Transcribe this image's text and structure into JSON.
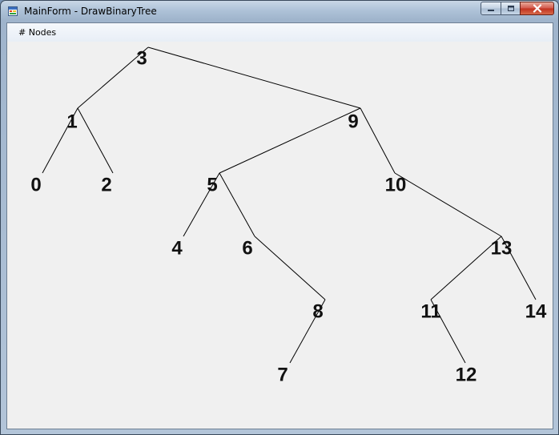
{
  "window": {
    "title": "MainForm - DrawBinaryTree",
    "icons": {
      "app": "app-form-icon",
      "minimize": "minimize-icon",
      "maximize": "maximize-icon",
      "close": "close-icon"
    }
  },
  "menu": {
    "items": [
      {
        "label": "# Nodes"
      }
    ]
  },
  "tree": {
    "nodes": [
      "0",
      "1",
      "2",
      "3",
      "4",
      "5",
      "6",
      "7",
      "8",
      "9",
      "10",
      "11",
      "12",
      "13",
      "14"
    ],
    "edges": [
      [
        "3",
        "1"
      ],
      [
        "3",
        "9"
      ],
      [
        "1",
        "0"
      ],
      [
        "1",
        "2"
      ],
      [
        "9",
        "5"
      ],
      [
        "9",
        "10"
      ],
      [
        "5",
        "4"
      ],
      [
        "5",
        "6"
      ],
      [
        "6",
        "8"
      ],
      [
        "8",
        "7"
      ],
      [
        "10",
        "13"
      ],
      [
        "13",
        "11"
      ],
      [
        "13",
        "14"
      ],
      [
        "11",
        "12"
      ]
    ]
  },
  "colors": {
    "canvas_background": "#f0f0f0",
    "edge": "#000000",
    "label": "#111111"
  }
}
